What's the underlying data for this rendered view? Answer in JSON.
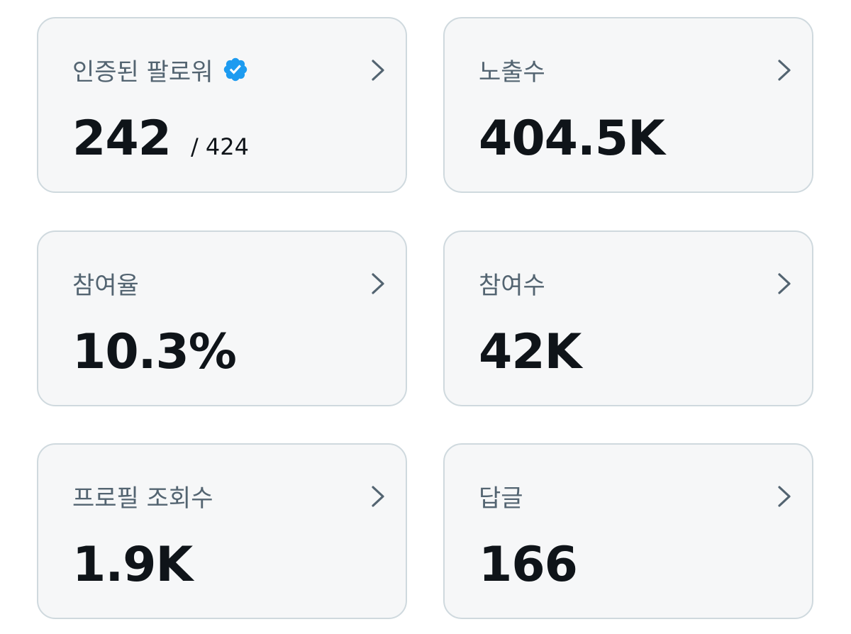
{
  "colors": {
    "card_background": "#f6f7f8",
    "card_border": "#cfd9de",
    "label": "#536471",
    "value": "#0f1419",
    "chevron": "#536471",
    "verified_badge": "#1d9bf0"
  },
  "cards": [
    {
      "label": "인증된 팔로워",
      "value": "242",
      "subvalue": "/ 424",
      "icon": "verified-badge-icon",
      "action_icon": "chevron-right-icon"
    },
    {
      "label": "노출수",
      "value": "404.5K",
      "action_icon": "chevron-right-icon"
    },
    {
      "label": "참여율",
      "value": "10.3%",
      "action_icon": "chevron-right-icon"
    },
    {
      "label": "참여수",
      "value": "42K",
      "action_icon": "chevron-right-icon"
    },
    {
      "label": "프로필 조회수",
      "value": "1.9K",
      "action_icon": "chevron-right-icon"
    },
    {
      "label": "답글",
      "value": "166",
      "action_icon": "chevron-right-icon"
    }
  ]
}
